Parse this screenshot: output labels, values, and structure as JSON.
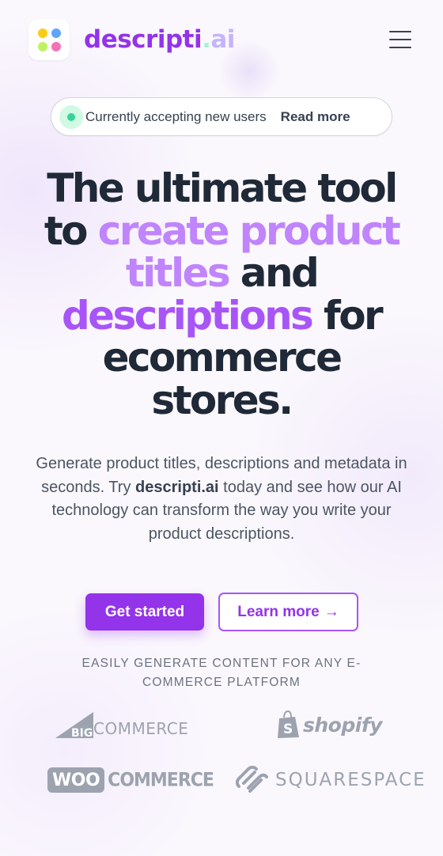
{
  "brand": {
    "name_main": "descripti",
    "name_dot": ".",
    "name_suffix": "ai",
    "colors": {
      "primary": "#9333ea",
      "suffix": "#c4b5fd",
      "dot": "#a7f3d0"
    },
    "logo_dot_colors": [
      "#facc15",
      "#60a5fa",
      "#bef264",
      "#f472b6"
    ]
  },
  "nav": {
    "menu_icon": "hamburger-menu-icon"
  },
  "notice": {
    "indicator_icon": "status-dot-icon",
    "text": "Currently accepting new users",
    "link": "Read more"
  },
  "hero": {
    "line1": "The ultimate tool",
    "line2_pre": "to ",
    "highlight1": "create product titles",
    "line3_post": " and",
    "highlight2": "descriptions",
    "line4_post": " for",
    "line5": "ecommerce",
    "line6": "stores."
  },
  "subtitle": {
    "part1": "Generate product titles, descriptions and metadata in seconds. Try ",
    "brand": "descripti.ai",
    "part2": " today and see how our AI technology can transform the way you write your product descriptions."
  },
  "cta": {
    "primary_label": "Get started",
    "secondary_label": "Learn more",
    "secondary_arrow": "→"
  },
  "platforms": {
    "heading": "Easily generate content for any e-commerce platform",
    "items": [
      {
        "name": "bigcommerce",
        "big": "BIG",
        "rest": "COMMERCE"
      },
      {
        "name": "shopify",
        "text": "shopify"
      },
      {
        "name": "woocommerce",
        "woo": "WOO",
        "rest": "COMMERCE"
      },
      {
        "name": "squarespace",
        "text": "SQUARESPACE"
      }
    ]
  }
}
